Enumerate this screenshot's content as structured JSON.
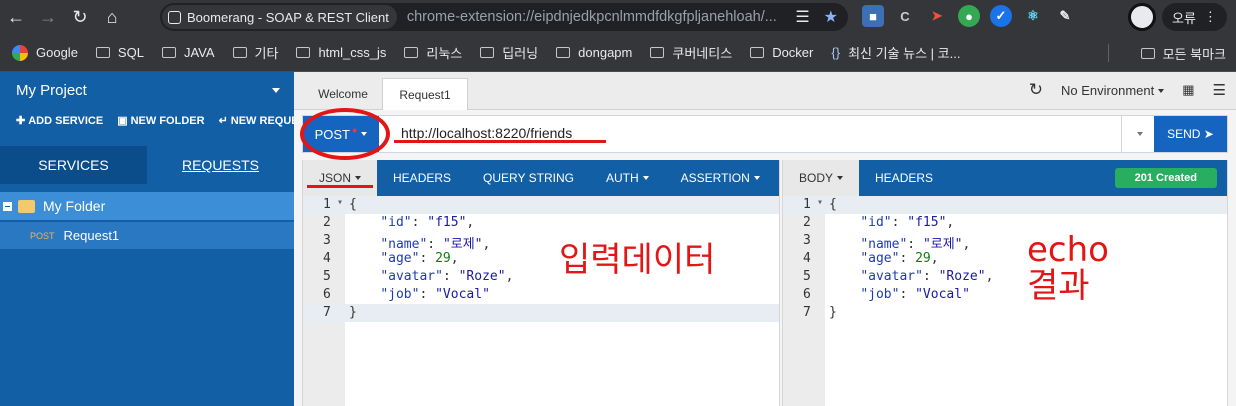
{
  "browser": {
    "tab_title": "Boomerang - SOAP & REST Client",
    "url": "chrome-extension://eipdnjedkpcnlmmdfdkgfpljanehloah/...",
    "profile_error": "오류",
    "bookmarks": [
      "Google",
      "SQL",
      "JAVA",
      "기타",
      "html_css_js",
      "리눅스",
      "딥러닝",
      "dongapm",
      "쿠버네티스",
      "Docker",
      "최신 기술 뉴스 | 코..."
    ],
    "all_bookmarks": "모든 북마크",
    "icons": [
      "back-icon",
      "forward-icon",
      "reload-icon",
      "home-icon",
      "translate-icon",
      "star-icon",
      "extensions-icon",
      "more-icon"
    ]
  },
  "sidebar": {
    "project": "My Project",
    "actions": [
      "ADD SERVICE",
      "NEW FOLDER",
      "NEW REQUEST"
    ],
    "tabs": [
      "SERVICES",
      "REQUESTS"
    ],
    "folder": "My Folder",
    "request": {
      "method": "POST",
      "name": "Request1"
    }
  },
  "main": {
    "tabs": [
      "Welcome",
      "Request1"
    ],
    "environment": "No Environment",
    "method": "POST",
    "url": "http://localhost:8220/friends",
    "send": "SEND ➤"
  },
  "request_panel": {
    "tabs": [
      "JSON",
      "HEADERS",
      "QUERY STRING",
      "AUTH",
      "ASSERTION"
    ],
    "line_numbers": [
      "1",
      "2",
      "3",
      "4",
      "5",
      "6",
      "7"
    ],
    "annotation": "입력데이터"
  },
  "response_panel": {
    "tabs": [
      "BODY",
      "HEADERS"
    ],
    "status": "201 Created",
    "line_numbers": [
      "1",
      "2",
      "3",
      "4",
      "5",
      "6",
      "7"
    ],
    "annotation_line1": "echo",
    "annotation_line2": "결과"
  },
  "json_body": {
    "open": "{",
    "close": "}",
    "fields": [
      {
        "key": "\"id\"",
        "value": "\"f15\"",
        "type": "string",
        "comma": ","
      },
      {
        "key": "\"name\"",
        "value": "\"로제\"",
        "type": "string",
        "comma": ","
      },
      {
        "key": "\"age\"",
        "value": "29",
        "type": "number",
        "comma": ","
      },
      {
        "key": "\"avatar\"",
        "value": "\"Roze\"",
        "type": "string",
        "comma": ","
      },
      {
        "key": "\"job\"",
        "value": "\"Vocal\"",
        "type": "string",
        "comma": ""
      }
    ]
  },
  "colors": {
    "sidebar": "#135fa6",
    "primary_button": "#1565c0",
    "status_ok": "#27ae60",
    "annotation": "#e31515"
  }
}
